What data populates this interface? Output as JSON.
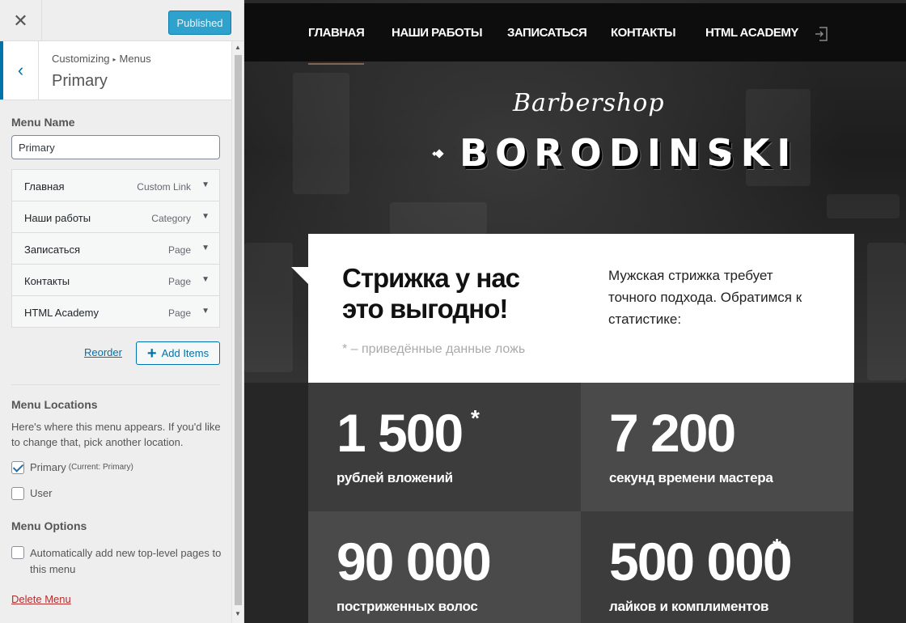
{
  "sidebar": {
    "close_label": "✕",
    "publish_label": "Published",
    "breadcrumb_parent": "Customizing",
    "breadcrumb_child": "Menus",
    "panel_title": "Primary",
    "menu_name_label": "Menu Name",
    "menu_name_value": "Primary",
    "menu_items": [
      {
        "title": "Главная",
        "type": "Custom Link"
      },
      {
        "title": "Наши работы",
        "type": "Category"
      },
      {
        "title": "Записаться",
        "type": "Page"
      },
      {
        "title": "Контакты",
        "type": "Page"
      },
      {
        "title": "HTML Academy",
        "type": "Page"
      }
    ],
    "reorder_label": "Reorder",
    "add_items_label": "Add Items",
    "locations_label": "Menu Locations",
    "locations_desc": "Here's where this menu appears. If you'd like to change that, pick another location.",
    "location_primary": "Primary",
    "location_primary_note": "(Current: Primary)",
    "location_user": "User",
    "options_label": "Menu Options",
    "auto_add_label": "Automatically add new top-level pages to this menu",
    "delete_label": "Delete Menu",
    "accent_color": "#0073aa",
    "publish_color": "#2ea2cc"
  },
  "preview": {
    "nav": [
      "ГЛАВНАЯ",
      "НАШИ РАБОТЫ",
      "ЗАПИСАТЬСЯ",
      "КОНТАКТЫ",
      "HTML ACADEMY"
    ],
    "logo_script": "Barbershop",
    "logo_main": "BORODINSKI",
    "promo_title": "Стрижка у нас это выгодно!",
    "promo_note": "* – приведённые данные ложь",
    "promo_text": "Мужская стрижка требует точного подхода. Обратимся к статистике:",
    "stats": [
      {
        "value": "1 500",
        "star": "*",
        "label": "рублей вложений"
      },
      {
        "value": "7 200",
        "star": "",
        "label": "секунд времени мастера"
      },
      {
        "value": "90 000",
        "star": "",
        "label": "постриженных волос"
      },
      {
        "value": "500 000",
        "star": "*",
        "label": "лайков и комплиментов"
      }
    ],
    "accent_color": "#826550"
  }
}
